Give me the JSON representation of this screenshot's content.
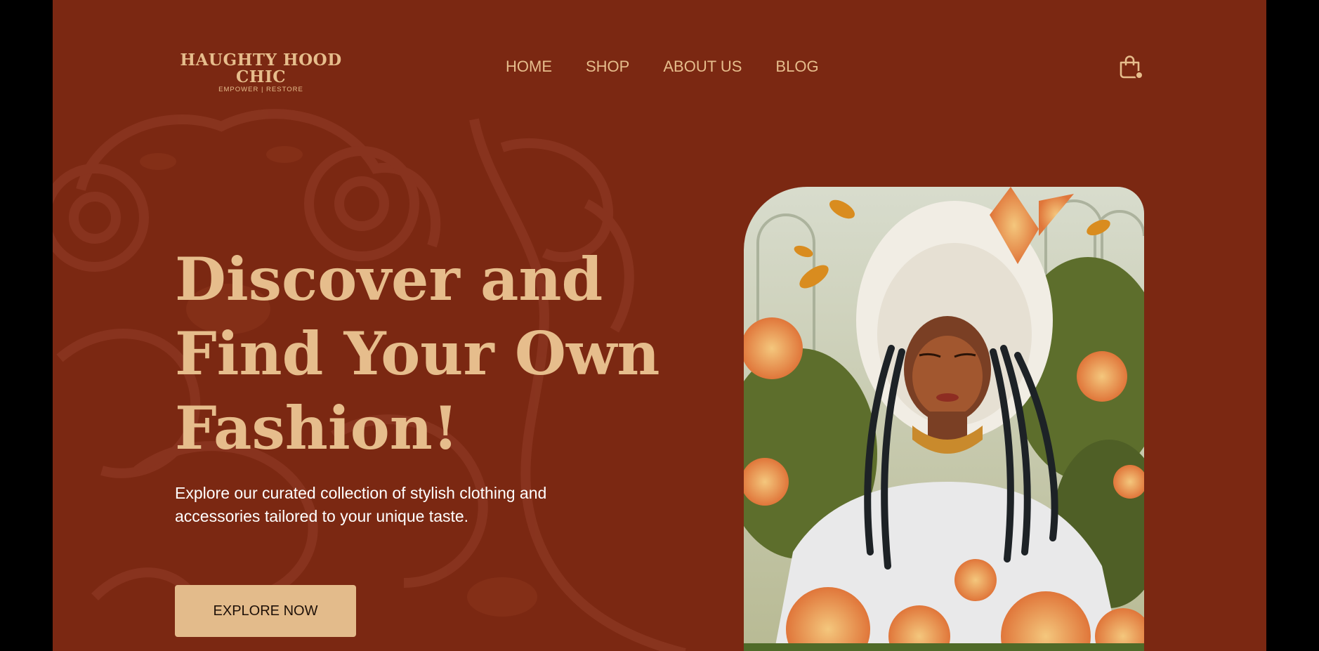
{
  "brand": {
    "name": "HAUGHTY HOOD CHIC",
    "tagline": "EMPOWER | RESTORE"
  },
  "nav": {
    "items": [
      {
        "label": "HOME"
      },
      {
        "label": "SHOP"
      },
      {
        "label": "ABOUT US"
      },
      {
        "label": "BLOG"
      }
    ]
  },
  "header": {
    "cart_icon": "shopping-bag-icon"
  },
  "hero": {
    "title_lines": [
      "Discover and",
      "Find Your Own",
      "Fashion!"
    ],
    "subtitle_lines": [
      "Explore our curated collection of stylish clothing and",
      "accessories tailored to your unique taste."
    ],
    "cta_label": "EXPLORE NOW"
  },
  "colors": {
    "background": "#7b2812",
    "accent": "#e6bd8c",
    "text_light": "#ffffff",
    "button_bg": "#e3bb8b"
  }
}
